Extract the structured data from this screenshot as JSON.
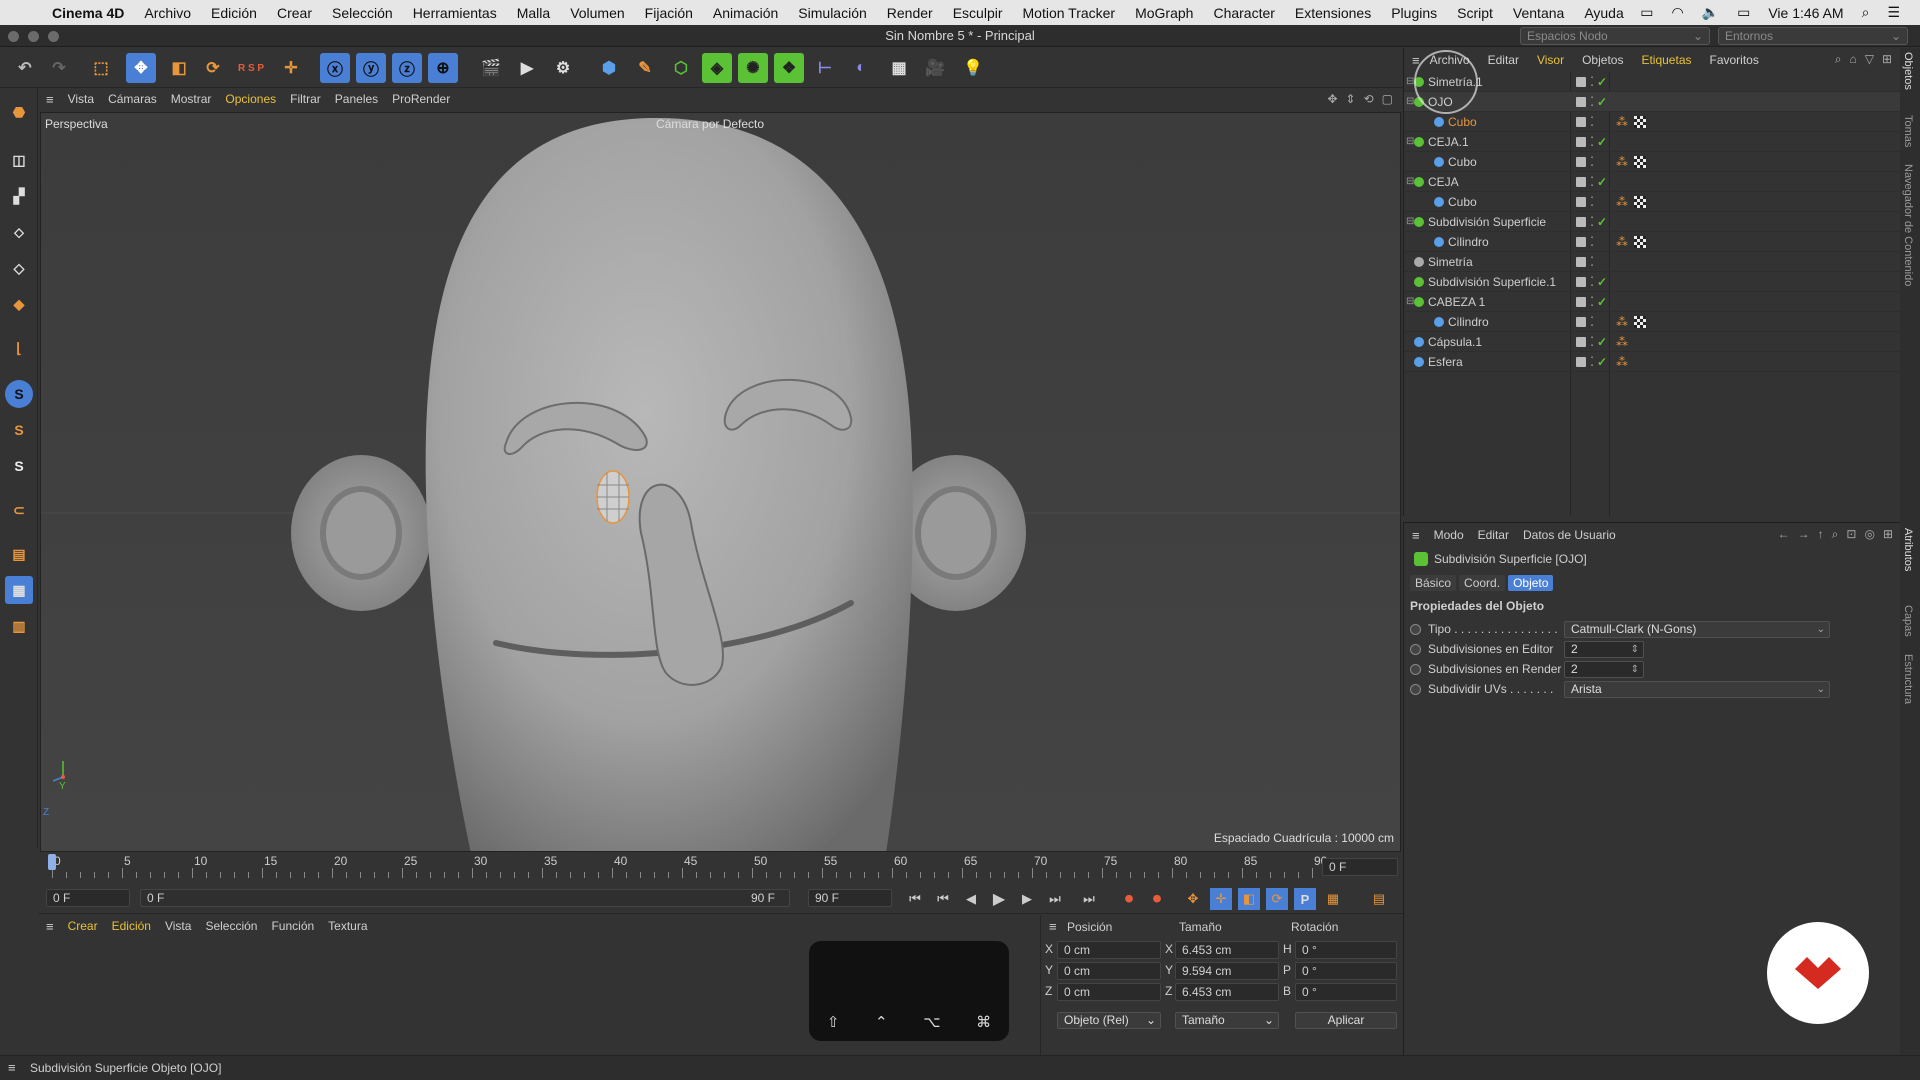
{
  "menubar": {
    "app": "Cinema 4D",
    "items": [
      "Archivo",
      "Edición",
      "Crear",
      "Selección",
      "Herramientas",
      "Malla",
      "Volumen",
      "Fijación",
      "Animación",
      "Simulación",
      "Render",
      "Esculpir",
      "Motion Tracker",
      "MoGraph",
      "Character",
      "Extensiones",
      "Plugins",
      "Script",
      "Ventana",
      "Ayuda"
    ],
    "clock": "Vie 1:46 AM"
  },
  "titlebar": {
    "title": "Sin Nombre 5 * - Principal",
    "layout_select": "Espacios Nodo",
    "env_select": "Entornos"
  },
  "viewport_menu": [
    "Vista",
    "Cámaras",
    "Mostrar",
    "Opciones",
    "Filtrar",
    "Paneles",
    "ProRender"
  ],
  "viewport": {
    "mode": "Perspectiva",
    "camera": "Cámara por Defecto",
    "grid_spacing": "Espaciado Cuadrícula : 10000 cm",
    "axis_y": "Y",
    "axis_z": "Z"
  },
  "timeline": {
    "ticks": [
      "0",
      "5",
      "10",
      "15",
      "20",
      "25",
      "30",
      "35",
      "40",
      "45",
      "50",
      "55",
      "60",
      "65",
      "70",
      "75",
      "80",
      "85",
      "90"
    ],
    "current_frame": "0 F",
    "start_frame": "0 F",
    "range_start": "0 F",
    "range_end": "90 F",
    "end_frame": "90 F"
  },
  "material_menu": [
    "Crear",
    "Edición",
    "Vista",
    "Selección",
    "Función",
    "Textura"
  ],
  "keys": [
    "⇧",
    "⌃",
    "⌥",
    "⌘"
  ],
  "coords": {
    "headers": {
      "pos": "Posición",
      "size": "Tamaño",
      "rot": "Rotación"
    },
    "rows": [
      {
        "axis": "X",
        "pos": "0 cm",
        "saxis": "X",
        "size": "6.453 cm",
        "raxis": "H",
        "rot": "0 °"
      },
      {
        "axis": "Y",
        "pos": "0 cm",
        "saxis": "Y",
        "size": "9.594 cm",
        "raxis": "P",
        "rot": "0 °"
      },
      {
        "axis": "Z",
        "pos": "0 cm",
        "saxis": "Z",
        "size": "6.453 cm",
        "raxis": "B",
        "rot": "0 °"
      }
    ],
    "mode_select": "Objeto (Rel)",
    "size_select": "Tamaño",
    "apply": "Aplicar"
  },
  "object_manager": {
    "menu": [
      "Archivo",
      "Editar",
      "Visor",
      "Objetos",
      "Etiquetas",
      "Favoritos"
    ],
    "rows": [
      {
        "name": "Simetría.1",
        "indent": 0,
        "icon": "null",
        "color": "#cfcfcf"
      },
      {
        "name": "OJO",
        "indent": 0,
        "icon": "subdiv",
        "color": "#cfcfcf"
      },
      {
        "name": "Cubo",
        "indent": 1,
        "icon": "poly",
        "color": "#e8963c"
      },
      {
        "name": "CEJA.1",
        "indent": 0,
        "icon": "subdiv",
        "color": "#cfcfcf"
      },
      {
        "name": "Cubo",
        "indent": 1,
        "icon": "poly",
        "color": "#cfcfcf"
      },
      {
        "name": "CEJA",
        "indent": 0,
        "icon": "subdiv",
        "color": "#cfcfcf"
      },
      {
        "name": "Cubo",
        "indent": 1,
        "icon": "poly",
        "color": "#cfcfcf"
      },
      {
        "name": "Subdivisión Superficie",
        "indent": 0,
        "icon": "subdiv",
        "color": "#cfcfcf"
      },
      {
        "name": "Cilindro",
        "indent": 1,
        "icon": "poly",
        "color": "#cfcfcf"
      },
      {
        "name": "Simetría",
        "indent": 0,
        "icon": "sym",
        "color": "#cfcfcf"
      },
      {
        "name": "Subdivisión Superficie.1",
        "indent": 0,
        "icon": "subdiv",
        "color": "#cfcfcf"
      },
      {
        "name": "CABEZA 1",
        "indent": 0,
        "icon": "subdiv",
        "color": "#cfcfcf"
      },
      {
        "name": "Cilindro",
        "indent": 1,
        "icon": "poly",
        "color": "#cfcfcf"
      },
      {
        "name": "Cápsula.1",
        "indent": 0,
        "icon": "capsule",
        "color": "#cfcfcf"
      },
      {
        "name": "Esfera",
        "indent": 0,
        "icon": "sphere",
        "color": "#cfcfcf"
      }
    ]
  },
  "attributes": {
    "menu": [
      "Modo",
      "Editar",
      "Datos de Usuario"
    ],
    "object_title": "Subdivisión Superficie [OJO]",
    "tabs": [
      "Básico",
      "Coord.",
      "Objeto"
    ],
    "active_tab": "Objeto",
    "section": "Propiedades del Objeto",
    "props": [
      {
        "label": "Tipo . . . . . . . . . . . . . . . .",
        "value": "Catmull-Clark (N-Gons)",
        "kind": "select"
      },
      {
        "label": "Subdivisiones en Editor",
        "value": "2",
        "kind": "number"
      },
      {
        "label": "Subdivisiones en Render",
        "value": "2",
        "kind": "number"
      },
      {
        "label": "Subdividir UVs . . . . . . .",
        "value": "Arista",
        "kind": "select"
      }
    ]
  },
  "right_tabs": {
    "top": [
      "Objetos",
      "Tomas",
      "Navegador de Contenido"
    ],
    "bottom": [
      "Atributos",
      "Capas",
      "Estructura"
    ]
  },
  "status": "Subdivisión Superficie Objeto [OJO]",
  "colors": {
    "accent_blue": "#4a7fd6",
    "orange": "#e8963c",
    "green_check": "#5bc236",
    "logo_red": "#d42a20"
  }
}
